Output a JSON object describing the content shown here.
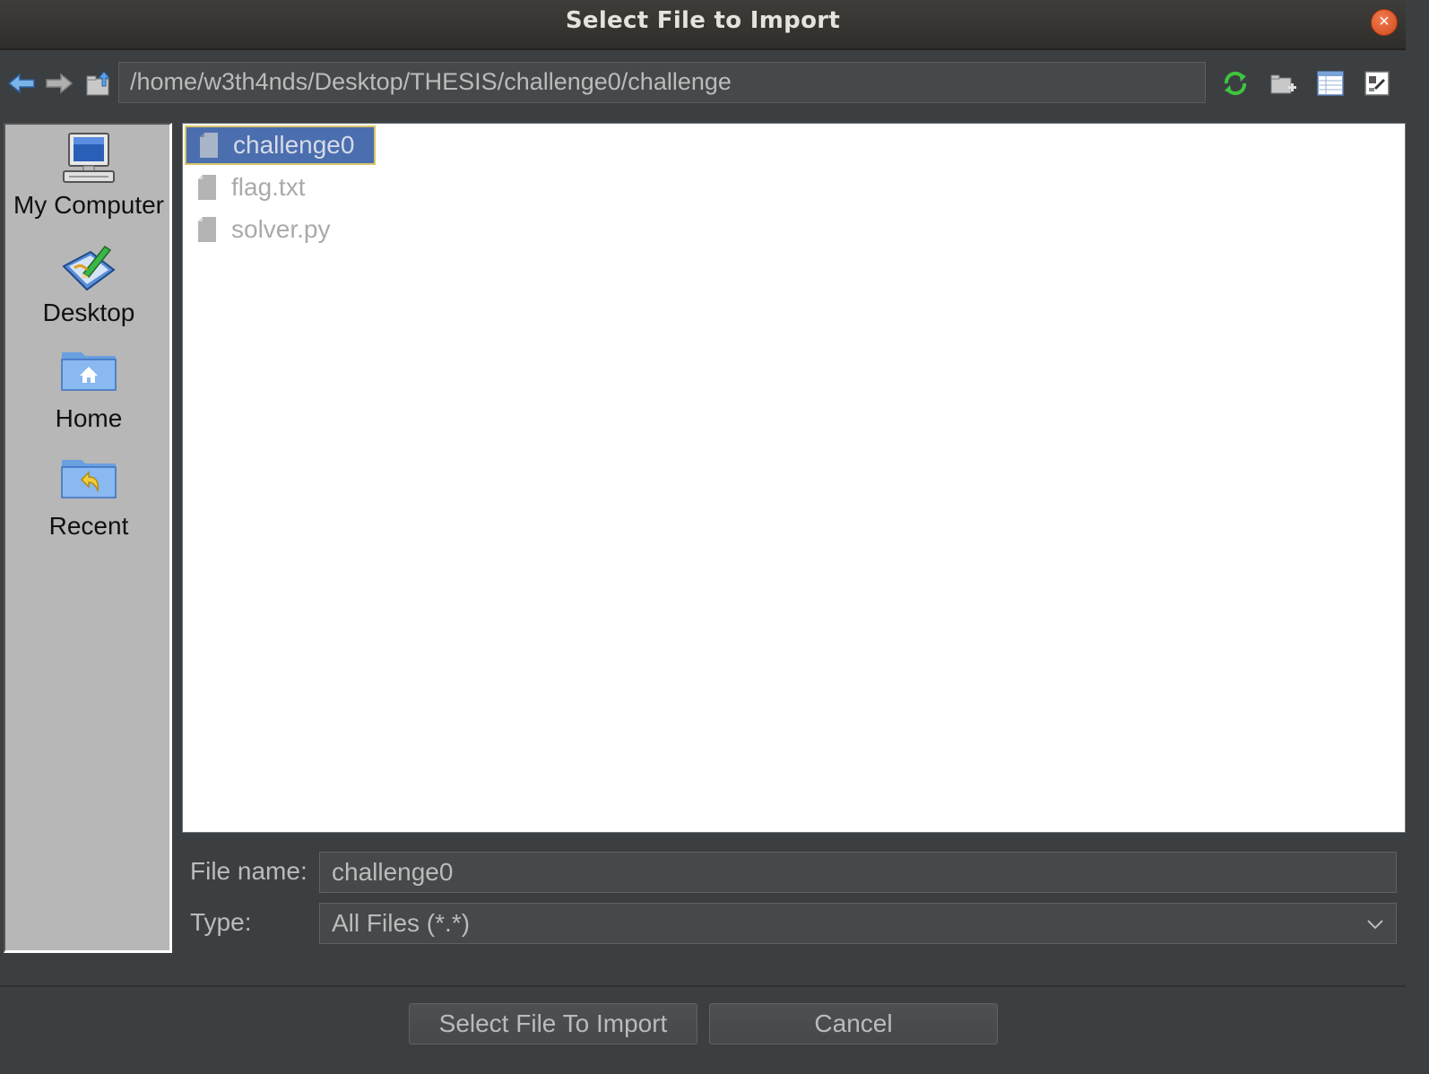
{
  "window": {
    "title": "Select File to Import",
    "close_glyph": "×"
  },
  "toolbar": {
    "path": "/home/w3th4nds/Desktop/THESIS/challenge0/challenge",
    "icons": [
      "back-arrow-icon",
      "forward-arrow-icon",
      "up-folder-icon",
      "refresh-icon",
      "new-folder-icon",
      "details-view-icon",
      "list-view-icon"
    ]
  },
  "sidebar": {
    "items": [
      {
        "label": "My Computer",
        "icon": "computer-icon"
      },
      {
        "label": "Desktop",
        "icon": "desktop-icon"
      },
      {
        "label": "Home",
        "icon": "home-folder-icon"
      },
      {
        "label": "Recent",
        "icon": "recent-folder-icon"
      }
    ]
  },
  "files": [
    {
      "name": "challenge0",
      "selected": true
    },
    {
      "name": "flag.txt",
      "selected": false
    },
    {
      "name": "solver.py",
      "selected": false
    }
  ],
  "form": {
    "filename_label": "File name:",
    "filename_value": "challenge0",
    "type_label": "Type:",
    "type_value": "All Files (*.*)"
  },
  "buttons": {
    "confirm": "Select File To Import",
    "cancel": "Cancel"
  },
  "colors": {
    "selection": "#4b6eaf",
    "background": "#3c3f41",
    "sidebar": "#b7b7b7",
    "close": "#e05a2b"
  }
}
